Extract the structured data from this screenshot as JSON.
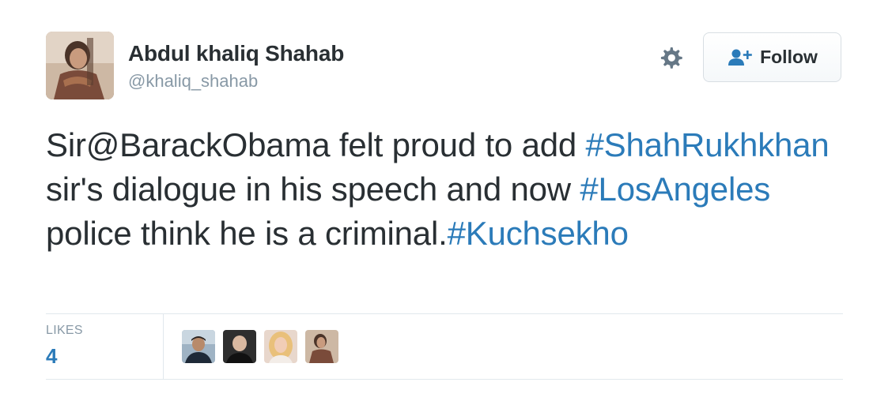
{
  "author": {
    "display_name": "Abdul khaliq Shahab",
    "screen_name": "@khaliq_shahab",
    "avatar_icon": "user-avatar-photo"
  },
  "actions": {
    "settings_icon": "gear-icon",
    "follow_label": "Follow",
    "follow_icon": "add-person-icon"
  },
  "tweet": {
    "segments": [
      {
        "type": "text",
        "value": "Sir@BarackObama felt proud to add "
      },
      {
        "type": "hashtag",
        "value": "#ShahRukhkhan"
      },
      {
        "type": "text",
        "value": " sir's dialogue in his speech and now "
      },
      {
        "type": "hashtag",
        "value": "#LosAngeles"
      },
      {
        "type": "text",
        "value": " police think he is a criminal."
      },
      {
        "type": "hashtag",
        "value": "#Kuchsekho"
      }
    ]
  },
  "stats": {
    "likes_label": "LIKES",
    "likes_count": "4",
    "likers": [
      {
        "name": "liker-avatar-1"
      },
      {
        "name": "liker-avatar-2"
      },
      {
        "name": "liker-avatar-3"
      },
      {
        "name": "liker-avatar-4"
      }
    ]
  },
  "colors": {
    "link": "#2b7bb9",
    "text": "#292f33",
    "muted": "#8899a6",
    "border": "#e1e8ed"
  }
}
